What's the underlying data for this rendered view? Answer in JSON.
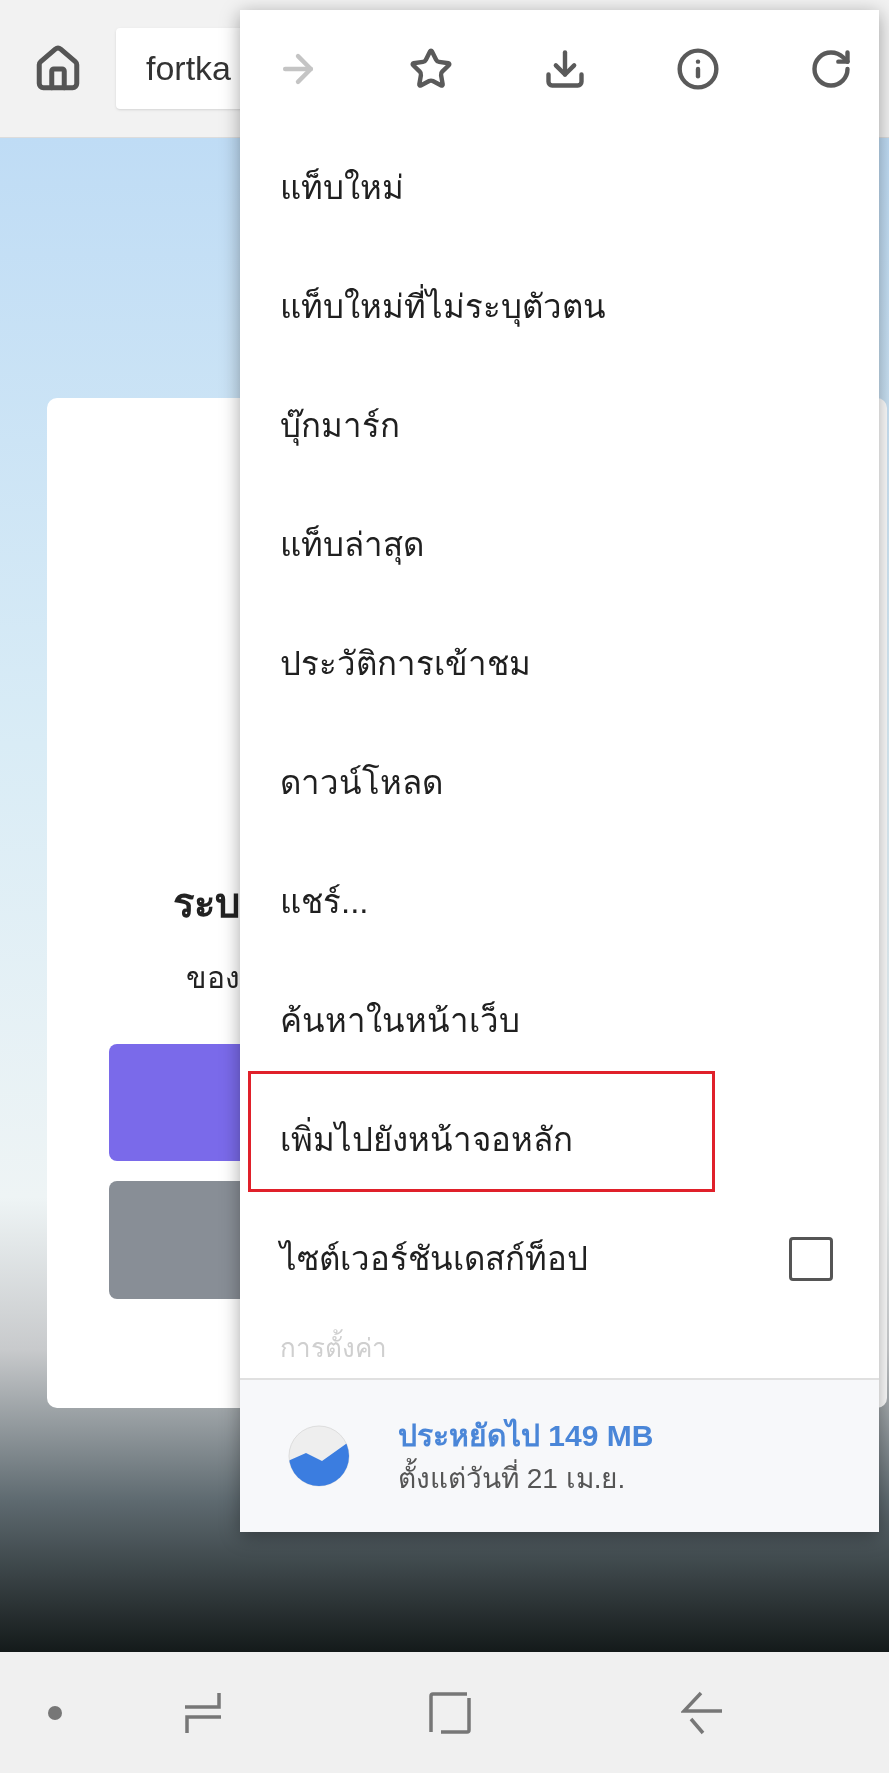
{
  "address_bar": {
    "url": "fortka"
  },
  "page": {
    "heading": "ระบ",
    "subtitle": "ของ"
  },
  "menu": {
    "toolbar": [
      {
        "kind": "forward",
        "disabled": true
      },
      {
        "kind": "bookmark",
        "disabled": false
      },
      {
        "kind": "download",
        "disabled": false
      },
      {
        "kind": "info",
        "disabled": false
      },
      {
        "kind": "reload",
        "disabled": false
      }
    ],
    "items": [
      {
        "kind": "link",
        "label": "แท็บใหม่",
        "highlighted": false,
        "faded": false
      },
      {
        "kind": "link",
        "label": "แท็บใหม่ที่ไม่ระบุตัวตน",
        "highlighted": false,
        "faded": false
      },
      {
        "kind": "link",
        "label": "บุ๊กมาร์ก",
        "highlighted": false,
        "faded": false
      },
      {
        "kind": "link",
        "label": "แท็บล่าสุด",
        "highlighted": false,
        "faded": false
      },
      {
        "kind": "link",
        "label": "ประวัติการเข้าชม",
        "highlighted": false,
        "faded": false
      },
      {
        "kind": "link",
        "label": "ดาวน์โหลด",
        "highlighted": false,
        "faded": false
      },
      {
        "kind": "link",
        "label": "แชร์...",
        "highlighted": false,
        "faded": false
      },
      {
        "kind": "link",
        "label": "ค้นหาในหน้าเว็บ",
        "highlighted": false,
        "faded": false
      },
      {
        "kind": "link",
        "label": "เพิ่มไปยังหน้าจอหลัก",
        "highlighted": true,
        "faded": false
      },
      {
        "kind": "checkbox",
        "label": "ไซต์เวอร์ชันเดสก์ท็อป",
        "checked": false,
        "highlighted": false,
        "faded": false
      },
      {
        "kind": "link",
        "label": "การตั้งค่า",
        "highlighted": false,
        "faded": true
      }
    ],
    "data_saver": {
      "title": "ประหยัดไป 149 MB",
      "subtitle": "ตั้งแต่วันที่ 21 เม.ย."
    }
  }
}
